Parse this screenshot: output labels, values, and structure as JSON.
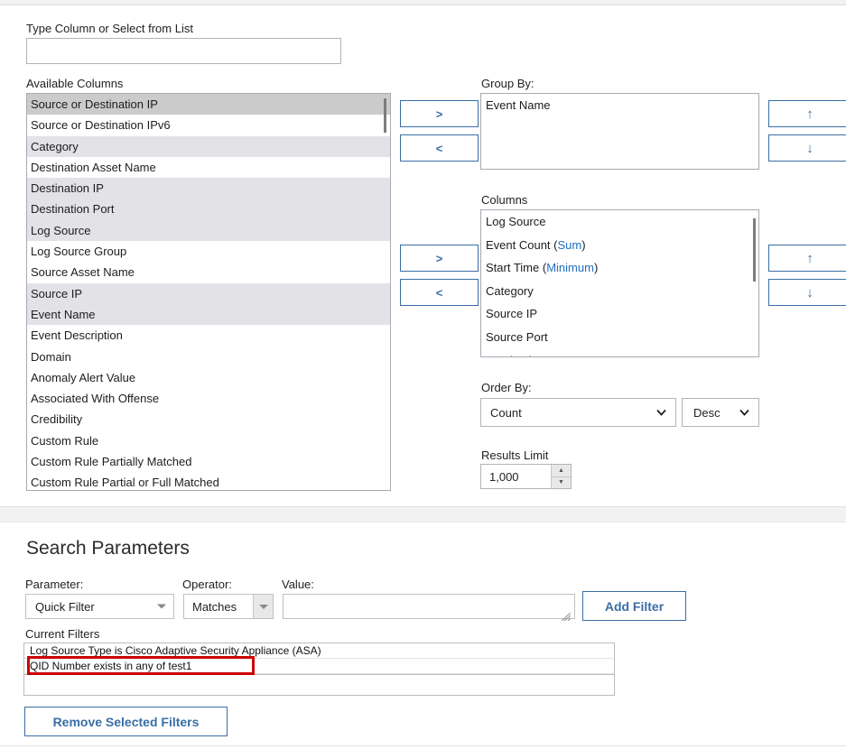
{
  "column_selection": {
    "type_column_label": "Type Column or Select from List",
    "type_column_value": "",
    "type_column_placeholder": "",
    "available_columns_label": "Available Columns",
    "available_columns": [
      {
        "label": "Source or Destination IP",
        "state": "sel-strong"
      },
      {
        "label": "Source or Destination IPv6",
        "state": "plain"
      },
      {
        "label": "Category",
        "state": "sel-light"
      },
      {
        "label": "Destination Asset Name",
        "state": "plain"
      },
      {
        "label": "Destination IP",
        "state": "sel-light"
      },
      {
        "label": "Destination Port",
        "state": "sel-light"
      },
      {
        "label": "Log Source",
        "state": "sel-light"
      },
      {
        "label": "Log Source Group",
        "state": "plain"
      },
      {
        "label": "Source Asset Name",
        "state": "plain"
      },
      {
        "label": "Source IP",
        "state": "sel-light"
      },
      {
        "label": "Event Name",
        "state": "sel-light"
      },
      {
        "label": "Event Description",
        "state": "plain"
      },
      {
        "label": "Domain",
        "state": "plain"
      },
      {
        "label": "Anomaly Alert Value",
        "state": "plain"
      },
      {
        "label": "Associated With Offense",
        "state": "plain"
      },
      {
        "label": "Credibility",
        "state": "plain"
      },
      {
        "label": "Custom Rule",
        "state": "plain"
      },
      {
        "label": "Custom Rule Partially Matched",
        "state": "plain"
      },
      {
        "label": "Custom Rule Partial or Full Matched",
        "state": "plain"
      }
    ],
    "transfer_buttons": {
      "group_add": ">",
      "group_remove": "<",
      "columns_add": ">",
      "columns_remove": "<"
    },
    "move_buttons": {
      "group_up": "↑",
      "group_down": "↓",
      "columns_up": "↑",
      "columns_down": "↓"
    },
    "group_by_label": "Group By:",
    "group_by_items": [
      {
        "label": "Event Name",
        "aggregate": ""
      }
    ],
    "columns_label": "Columns",
    "columns_items": [
      {
        "label": "Log Source",
        "aggregate": ""
      },
      {
        "label": "Event Count",
        "aggregate": "Sum"
      },
      {
        "label": "Start Time",
        "aggregate": "Minimum"
      },
      {
        "label": "Category",
        "aggregate": ""
      },
      {
        "label": "Source IP",
        "aggregate": ""
      },
      {
        "label": "Source Port",
        "aggregate": ""
      },
      {
        "label": "Destination IP",
        "aggregate": ""
      }
    ],
    "order_by_label": "Order By:",
    "order_by_value": "Count",
    "order_direction_value": "Desc",
    "results_limit_label": "Results Limit",
    "results_limit_value": "1,000"
  },
  "search_parameters": {
    "title": "Search Parameters",
    "parameter_label": "Parameter:",
    "parameter_value": "Quick Filter",
    "operator_label": "Operator:",
    "operator_value": "Matches",
    "value_label": "Value:",
    "value_text": "",
    "value_placeholder": "",
    "add_filter_label": "Add Filter",
    "current_filters_label": "Current Filters",
    "current_filters": [
      "Log Source Type is Cisco Adaptive Security Appliance (ASA)",
      "QID Number exists in any of test1"
    ],
    "highlighted_filter_index": 1,
    "remove_selected_label": "Remove Selected Filters"
  },
  "colors": {
    "accent_blue": "#3a6ea5",
    "link_blue": "#1f6fc4",
    "highlight_red": "#cc0000",
    "selected_row": "#cbcbcb",
    "selected_row_light": "#e2e2e7"
  }
}
